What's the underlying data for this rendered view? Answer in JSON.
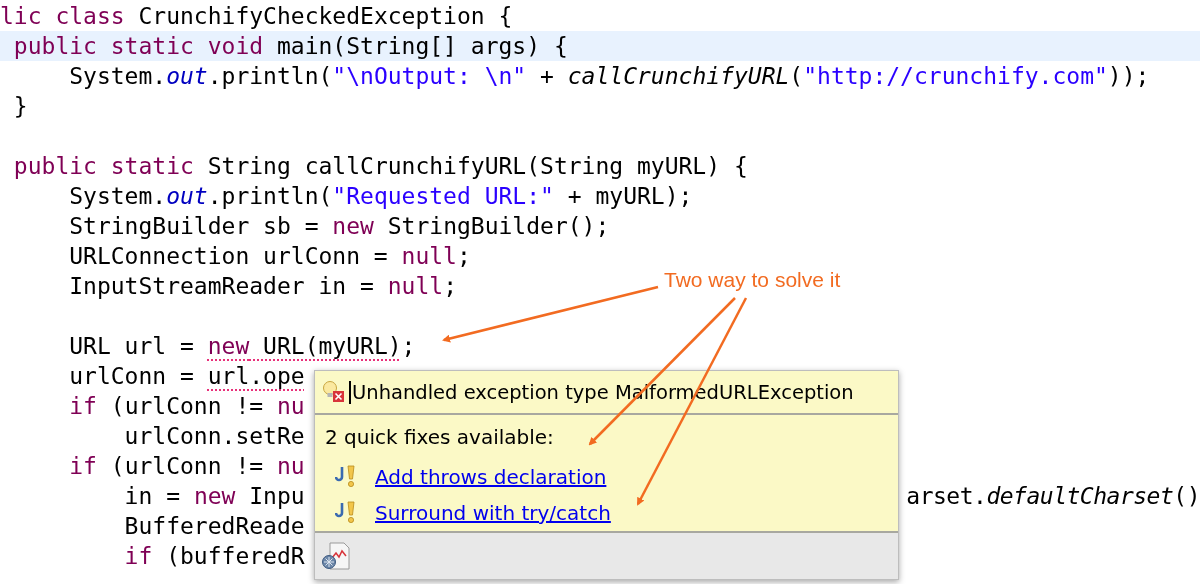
{
  "lines": [
    {
      "current": false,
      "tokens": [
        {
          "kind": "kw",
          "text": "lic class "
        },
        {
          "kind": "plain",
          "text": "CrunchifyCheckedException {"
        }
      ]
    },
    {
      "current": true,
      "tokens": [
        {
          "kind": "kw",
          "text": " public static void "
        },
        {
          "kind": "plain",
          "text": "main(String[] args) {"
        }
      ]
    },
    {
      "current": false,
      "tokens": [
        {
          "kind": "plain",
          "text": "     System."
        },
        {
          "kind": "field",
          "text": "out"
        },
        {
          "kind": "plain",
          "text": ".println("
        },
        {
          "kind": "str",
          "text": "\"\\nOutput: \\n\""
        },
        {
          "kind": "plain",
          "text": " + "
        },
        {
          "kind": "ital",
          "text": "callCrunchifyURL"
        },
        {
          "kind": "plain",
          "text": "("
        },
        {
          "kind": "str",
          "text": "\"http://crunchify.com\""
        },
        {
          "kind": "plain",
          "text": "));"
        }
      ]
    },
    {
      "current": false,
      "tokens": [
        {
          "kind": "plain",
          "text": " }"
        }
      ]
    },
    {
      "current": false
    },
    {
      "current": false,
      "tokens": [
        {
          "kind": "kw",
          "text": " public static "
        },
        {
          "kind": "plain",
          "text": "String callCrunchifyURL(String myURL) {"
        }
      ]
    },
    {
      "current": false,
      "tokens": [
        {
          "kind": "plain",
          "text": "     System."
        },
        {
          "kind": "field",
          "text": "out"
        },
        {
          "kind": "plain",
          "text": ".println("
        },
        {
          "kind": "str",
          "text": "\"Requested URL:\""
        },
        {
          "kind": "plain",
          "text": " + myURL);"
        }
      ]
    },
    {
      "current": false,
      "tokens": [
        {
          "kind": "plain",
          "text": "     StringBuilder sb = "
        },
        {
          "kind": "kw",
          "text": "new"
        },
        {
          "kind": "plain",
          "text": " StringBuilder();"
        }
      ]
    },
    {
      "current": false,
      "tokens": [
        {
          "kind": "plain",
          "text": "     URLConnection urlConn = "
        },
        {
          "kind": "kw",
          "text": "null"
        },
        {
          "kind": "plain",
          "text": ";"
        }
      ]
    },
    {
      "current": false,
      "tokens": [
        {
          "kind": "plain",
          "text": "     InputStreamReader in = "
        },
        {
          "kind": "kw",
          "text": "null"
        },
        {
          "kind": "plain",
          "text": ";"
        }
      ]
    },
    {
      "current": false
    },
    {
      "current": false,
      "tokens": [
        {
          "kind": "plain",
          "text": "     URL url = ",
          "err": false
        },
        {
          "kind": "kw",
          "text": "new",
          "err": true
        },
        {
          "kind": "plain",
          "text": " URL(myURL)",
          "err": true
        },
        {
          "kind": "plain",
          "text": ";",
          "err": false
        }
      ]
    },
    {
      "current": false,
      "tokens": [
        {
          "kind": "plain",
          "text": "     urlConn = ",
          "err": false
        },
        {
          "kind": "plain",
          "text": "url.ope",
          "err": true
        }
      ]
    },
    {
      "current": false,
      "tokens": [
        {
          "kind": "kw",
          "text": "     if"
        },
        {
          "kind": "plain",
          "text": " (urlConn != "
        },
        {
          "kind": "kw",
          "text": "nu"
        }
      ]
    },
    {
      "current": false,
      "tokens": [
        {
          "kind": "plain",
          "text": "         urlConn.setRe"
        }
      ]
    },
    {
      "current": false,
      "tokens": [
        {
          "kind": "kw",
          "text": "     if"
        },
        {
          "kind": "plain",
          "text": " (urlConn != "
        },
        {
          "kind": "kw",
          "text": "nu"
        }
      ]
    },
    {
      "current": false,
      "tokens": [
        {
          "kind": "plain",
          "text": "         in = "
        },
        {
          "kind": "kw",
          "text": "new"
        },
        {
          "kind": "plain",
          "text": " Inpu"
        }
      ],
      "tail": [
        {
          "kind": "plain",
          "text": "arset."
        },
        {
          "kind": "ital",
          "text": "defaultCharset"
        },
        {
          "kind": "plain",
          "text": "()"
        }
      ]
    },
    {
      "current": false,
      "tokens": [
        {
          "kind": "plain",
          "text": "         BufferedReade"
        }
      ]
    },
    {
      "current": false,
      "tokens": [
        {
          "kind": "kw",
          "text": "         if"
        },
        {
          "kind": "plain",
          "text": " (bufferedR"
        }
      ]
    }
  ],
  "popup": {
    "message": "Unhandled exception type MalformedURLException",
    "fixes_title": "2 quick fixes available:",
    "fixes": [
      "Add throws declaration",
      "Surround with try/catch"
    ]
  },
  "annotation": {
    "text": "Two way to solve it"
  }
}
